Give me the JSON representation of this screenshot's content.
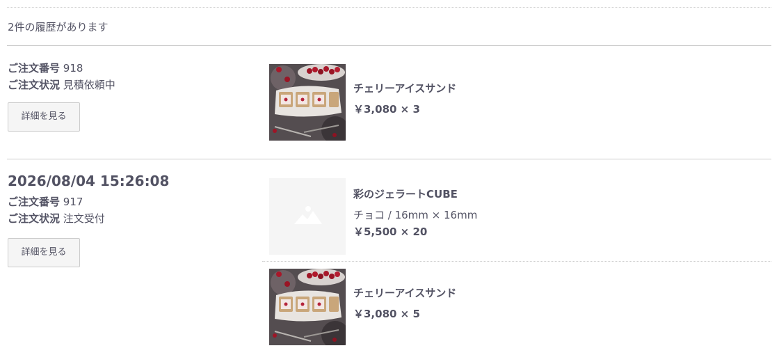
{
  "history": {
    "count_text": "2件の履歴があります"
  },
  "orders": [
    {
      "date": "",
      "number_label": "ご注文番号",
      "number": "918",
      "status_label": "ご注文状況",
      "status": "見積依頼中",
      "detail_button": "詳細を見る",
      "items": [
        {
          "name": "チェリーアイスサンド",
          "variant": "",
          "price_qty": "￥3,080 × 3",
          "image": "cherry-ice-sandwich-photo"
        }
      ]
    },
    {
      "date": "2026/08/04 15:26:08",
      "number_label": "ご注文番号",
      "number": "917",
      "status_label": "ご注文状況",
      "status": "注文受付",
      "detail_button": "詳細を見る",
      "items": [
        {
          "name": "彩のジェラートCUBE",
          "variant": "チョコ / 16mm × 16mm",
          "price_qty": "￥5,500 × 20",
          "image": "no-image-placeholder"
        },
        {
          "name": "チェリーアイスサンド",
          "variant": "",
          "price_qty": "￥3,080 × 5",
          "image": "cherry-ice-sandwich-photo"
        }
      ]
    }
  ],
  "colors": {
    "text": "#525263",
    "rule": "#cccccc",
    "button_bg": "#f5f5f5",
    "placeholder_bg": "#f5f5f5"
  }
}
